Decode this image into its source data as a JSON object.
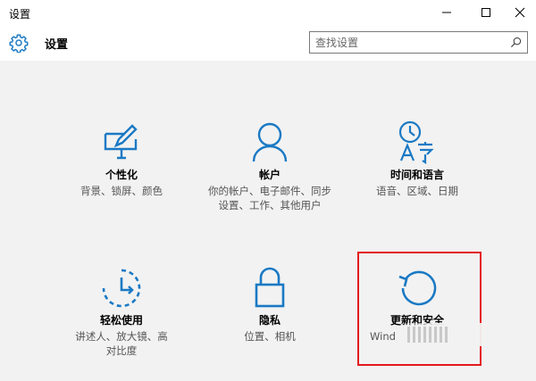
{
  "window": {
    "title": "设置",
    "controls": [
      "minimize",
      "maximize",
      "close"
    ]
  },
  "header": {
    "app_icon": "gear-icon",
    "title": "设置",
    "search": {
      "placeholder": "查找设置",
      "value": "",
      "icon": "search-icon"
    }
  },
  "tiles": [
    {
      "icon": "personalization-icon",
      "name": "个性化",
      "desc": "背景、锁屏、颜色"
    },
    {
      "icon": "account-icon",
      "name": "帐户",
      "desc": "你的帐户、电子邮件、同步设置、工作、其他用户"
    },
    {
      "icon": "time-language-icon",
      "name": "时间和语言",
      "desc": "语音、区域、日期"
    },
    {
      "icon": "ease-of-access-icon",
      "name": "轻松使用",
      "desc": "讲述人、放大镜、高对比度"
    },
    {
      "icon": "privacy-lock-icon",
      "name": "隐私",
      "desc": "位置、相机"
    },
    {
      "icon": "update-security-icon",
      "name": "更新和安全",
      "desc": "Wind"
    }
  ],
  "colors": {
    "accent": "#1a79c4",
    "background": "#f2f2f2",
    "highlight": "#e3181d"
  }
}
